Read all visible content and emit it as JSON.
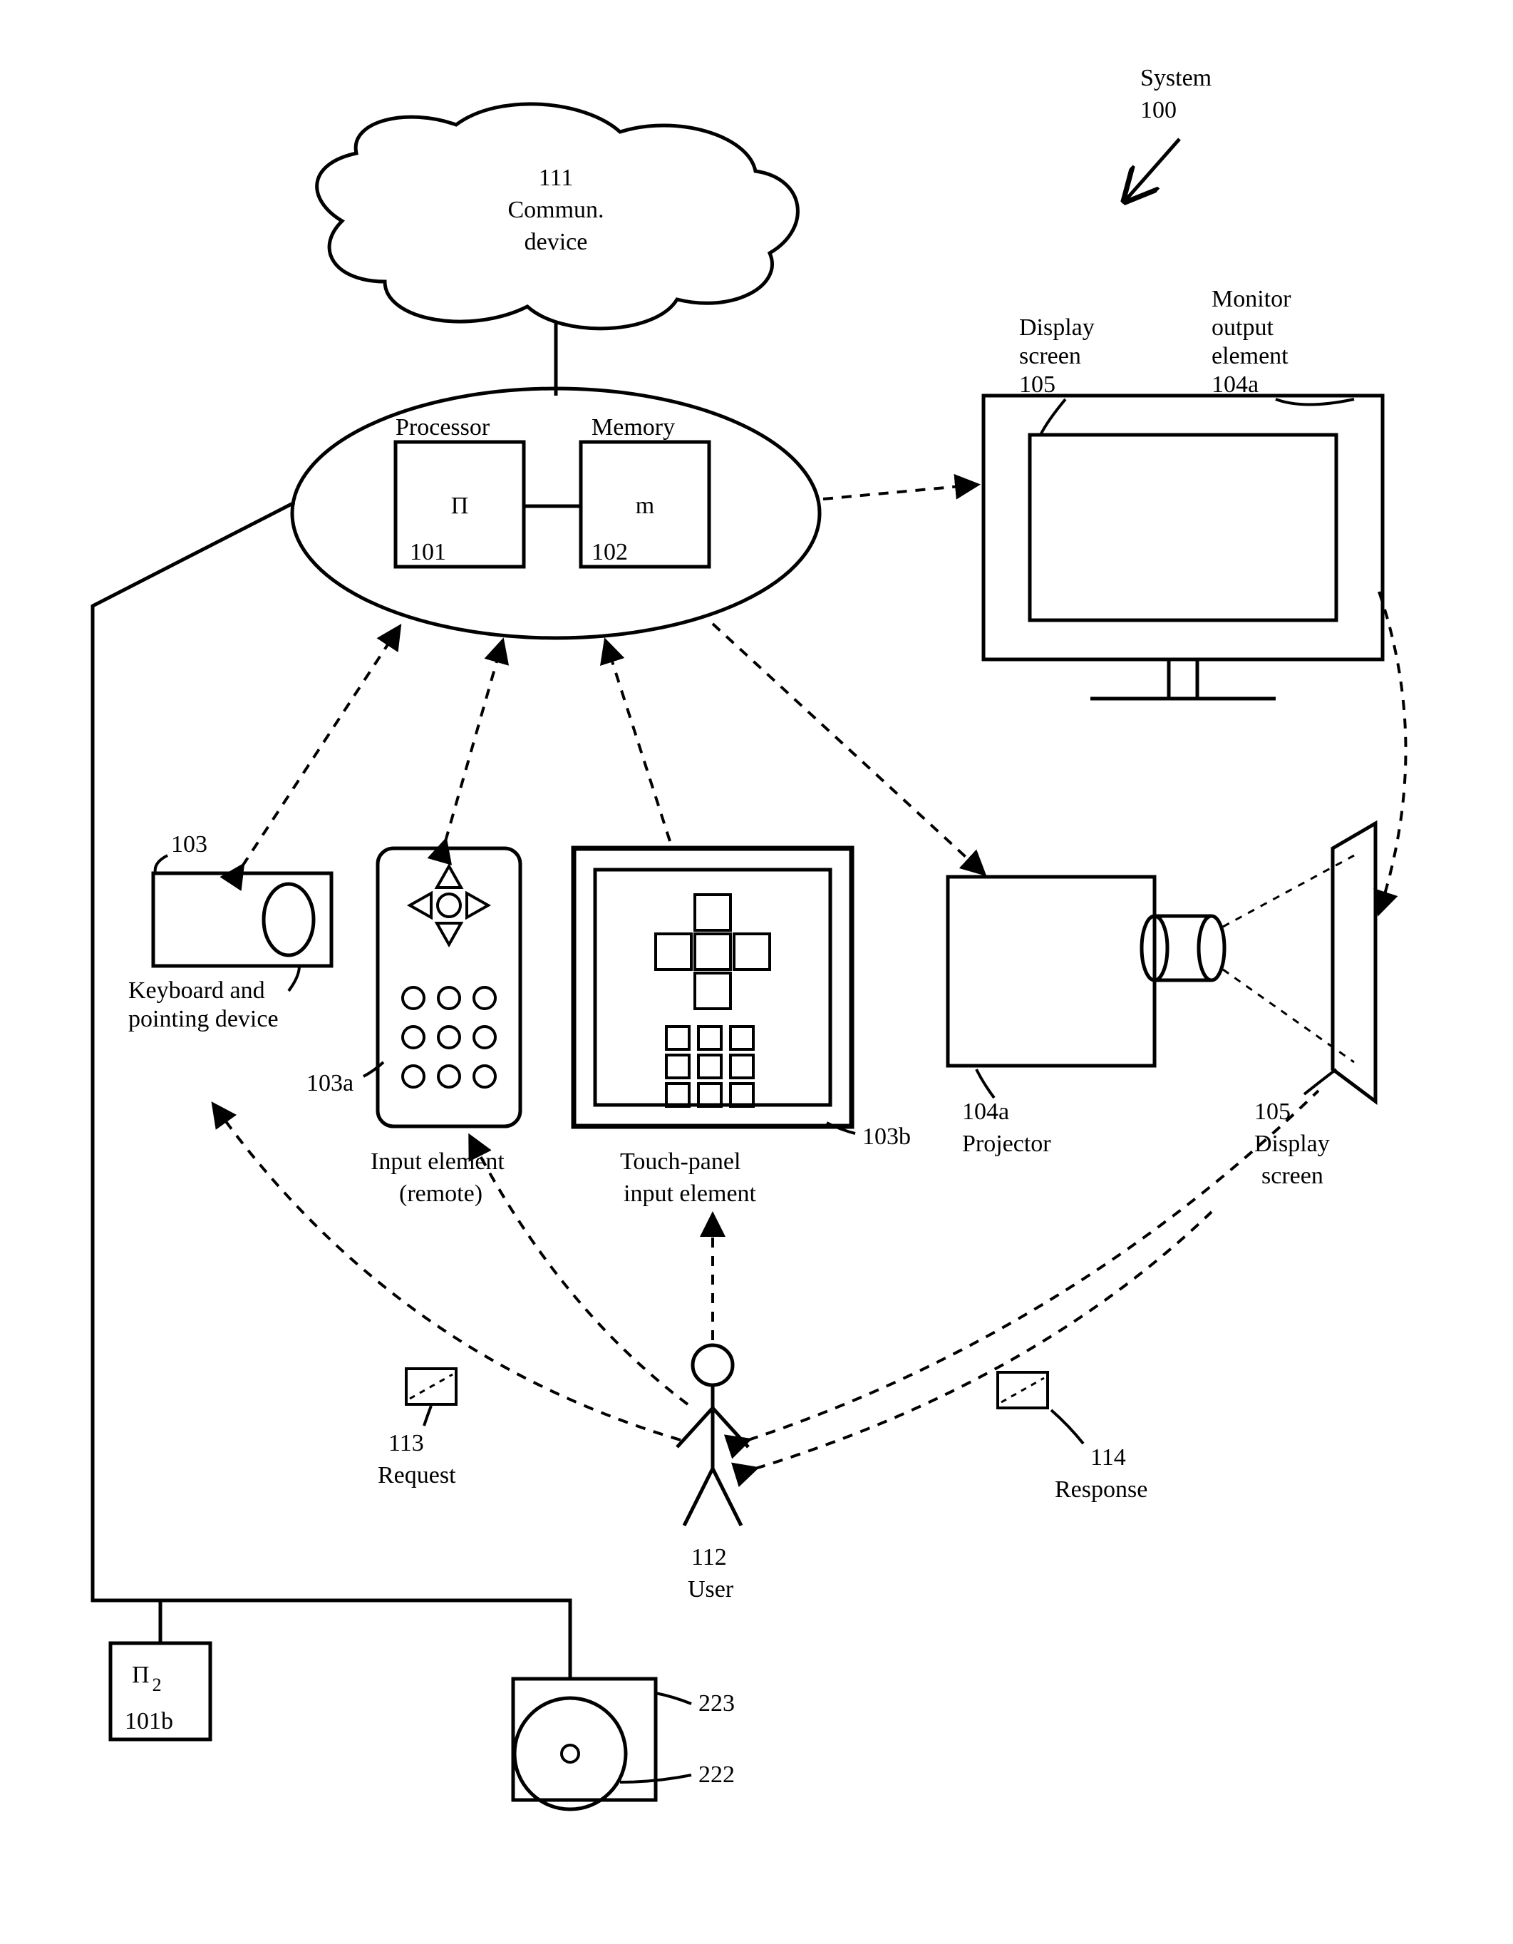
{
  "system": {
    "ref": "100",
    "name": "System"
  },
  "cloud": {
    "ref": "111",
    "name": "Commun.",
    "name2": "device"
  },
  "processor": {
    "ref": "101",
    "name": "Processor",
    "sym": "Π"
  },
  "memory": {
    "ref": "102",
    "name": "Memory",
    "sym": "m"
  },
  "monitor": {
    "ref": "104a",
    "name": "Monitor",
    "name2": "output",
    "name3": "element"
  },
  "disp_screen": {
    "ref": "105",
    "name": "Display",
    "name2": "screen"
  },
  "keyboard": {
    "ref": "103",
    "name": "Keyboard and",
    "name2": "pointing device"
  },
  "remote": {
    "ref": "103a",
    "name": "Input element",
    "name2": "(remote)"
  },
  "touchpanel": {
    "ref": "103b",
    "name": "Touch-panel",
    "name2": "input element"
  },
  "projector": {
    "ref": "104a",
    "name": "Projector"
  },
  "proj_screen": {
    "ref": "105",
    "name": "Display",
    "name2": "screen"
  },
  "request": {
    "ref": "113",
    "name": "Request"
  },
  "response": {
    "ref": "114",
    "name": "Response"
  },
  "user": {
    "ref": "112",
    "name": "User"
  },
  "proc2": {
    "ref": "101b",
    "sym": "Π",
    "sub": "2"
  },
  "disc_large": {
    "ref": "223"
  },
  "disc_small": {
    "ref": "222"
  }
}
